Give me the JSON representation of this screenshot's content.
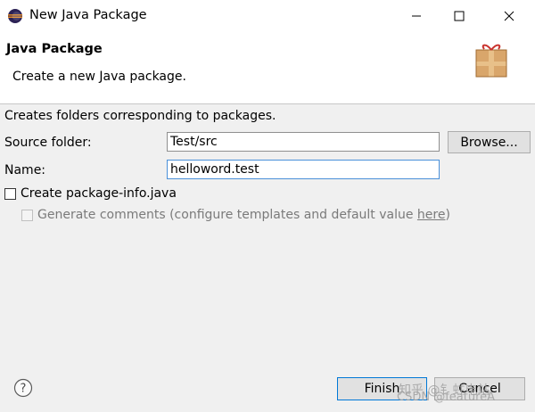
{
  "window": {
    "title": "New Java Package",
    "icon": "eclipse-icon"
  },
  "header": {
    "title": "Java Package",
    "description": "Create a new Java package.",
    "icon": "package-icon"
  },
  "form": {
    "info_text": "Creates folders corresponding to packages.",
    "source_folder_label": "Source folder:",
    "source_folder_value": "Test/src",
    "browse_label": "Browse...",
    "name_label": "Name:",
    "name_value": "helloword.test",
    "create_package_info_label": "Create package-info.java",
    "create_package_info_checked": false,
    "generate_comments_prefix": "Generate comments (configure templates and default value ",
    "generate_comments_link": "here",
    "generate_comments_suffix": ")",
    "generate_comments_enabled": false
  },
  "footer": {
    "help_icon": "help-icon",
    "finish_label": "Finish",
    "cancel_label": "Cancel"
  },
  "watermark": {
    "line1": "知乎 @钅蛀电站",
    "line2": "CSDN @featureA"
  },
  "colors": {
    "focus_border": "#4a90d9",
    "default_button_border": "#0078d7",
    "disabled_text": "#7a7a7a"
  }
}
